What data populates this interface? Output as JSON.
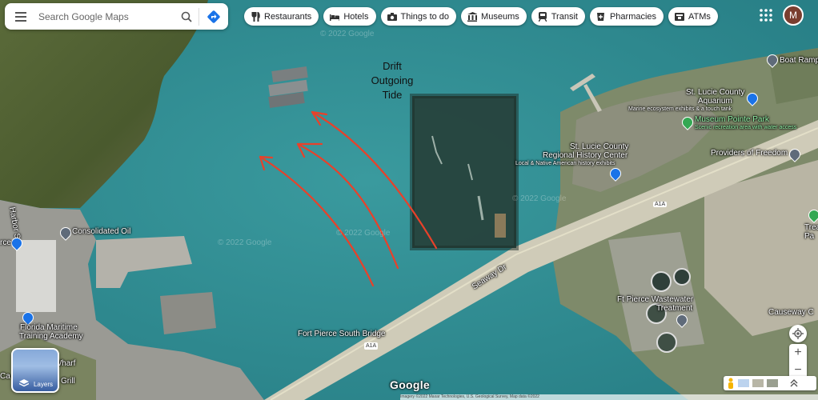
{
  "search": {
    "placeholder": "Search Google Maps"
  },
  "chips": [
    {
      "icon": "fork-knife-icon",
      "label": "Restaurants"
    },
    {
      "icon": "bed-icon",
      "label": "Hotels"
    },
    {
      "icon": "camera-icon",
      "label": "Things to do"
    },
    {
      "icon": "museum-icon",
      "label": "Museums"
    },
    {
      "icon": "train-icon",
      "label": "Transit"
    },
    {
      "icon": "pill-icon",
      "label": "Pharmacies"
    },
    {
      "icon": "atm-icon",
      "label": "ATMs"
    }
  ],
  "user": {
    "initial": "M",
    "color": "#7a3e2f"
  },
  "annotation": {
    "line1": "Drift",
    "line2": "Outgoing",
    "line3": "Tide",
    "arrow_color": "#e8412a"
  },
  "places": {
    "boat_ramp": "Boat Ramp",
    "aquarium_1": "St. Lucie County",
    "aquarium_2": "Aquarium",
    "aquarium_desc": "Marine ecosystem exhibits & a touch tank",
    "museum_point": "Museum Pointe Park",
    "museum_point_desc": "Scenic recreation area with water access",
    "providers": "Providers of Freedom",
    "history_1": "St. Lucie County",
    "history_2": "Regional History Center",
    "history_desc": "Local & Native American history exhibits",
    "consolidated_oil": "Consolidated Oil",
    "harbor_st": "Harbor St",
    "maritime_1": "Florida Maritime",
    "maritime_2": "Training Academy",
    "wharf": "'s Wharf",
    "grill": "Grill",
    "south_bridge": "Fort Pierce South Bridge",
    "route": "A1A",
    "highway_shield": "A1A",
    "seaway": "Seaway Dr",
    "wastewater_1": "Ft Pierce Wastewater",
    "wastewater_2": "Treatment",
    "causeway": "Causeway C",
    "trea": "Trea",
    "pa": "Pa",
    "ce": "rce",
    "ca": "Ca",
    "watermark": "© 2022 Google"
  },
  "controls": {
    "layers": "Layers",
    "zoom_in": "+",
    "zoom_out": "−"
  },
  "brand": "Google",
  "footer": "Imagery ©2022 Maxar Technologies, U.S. Geological Survey, Map data ©2022"
}
